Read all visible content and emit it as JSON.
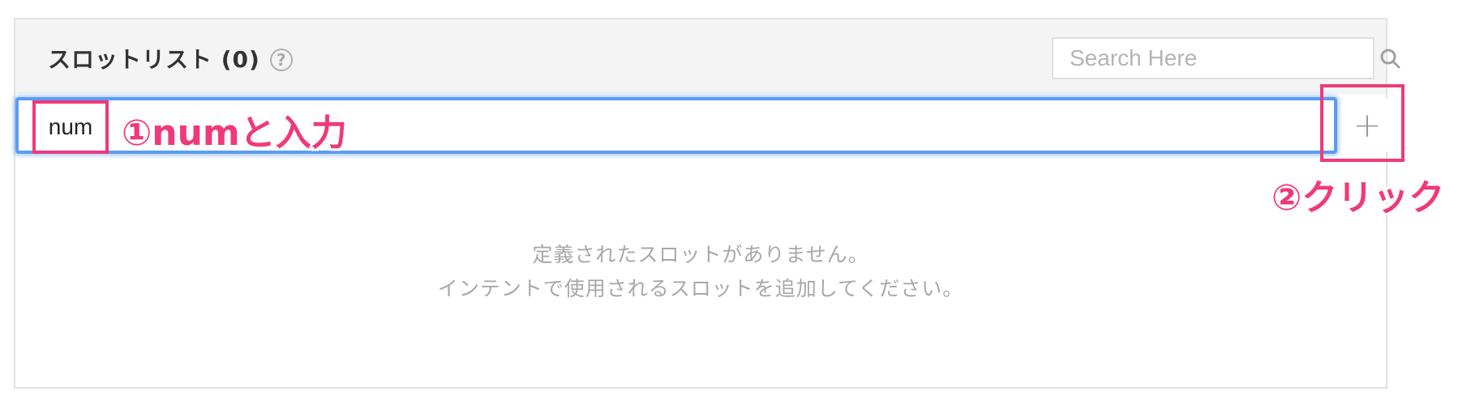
{
  "slot_panel": {
    "title": "スロットリスト (0)",
    "help_icon": "question-circle-icon",
    "search": {
      "placeholder": "Search Here",
      "icon": "search-icon"
    },
    "slot_input_value": "",
    "add_button": {
      "label": "+",
      "icon": "plus-icon"
    },
    "empty_message": {
      "line1": "定義されたスロットがありません。",
      "line2": "インテントで使用されるスロットを追加してください。"
    }
  },
  "annotations": {
    "typed_value": "num",
    "step1": "①numと入力",
    "step2": "②クリック",
    "highlight_color": "#f0397a"
  },
  "colors": {
    "header_bg": "#f4f4f4",
    "focus_border": "#5b9cf1",
    "muted_text": "#a8a8a8"
  }
}
